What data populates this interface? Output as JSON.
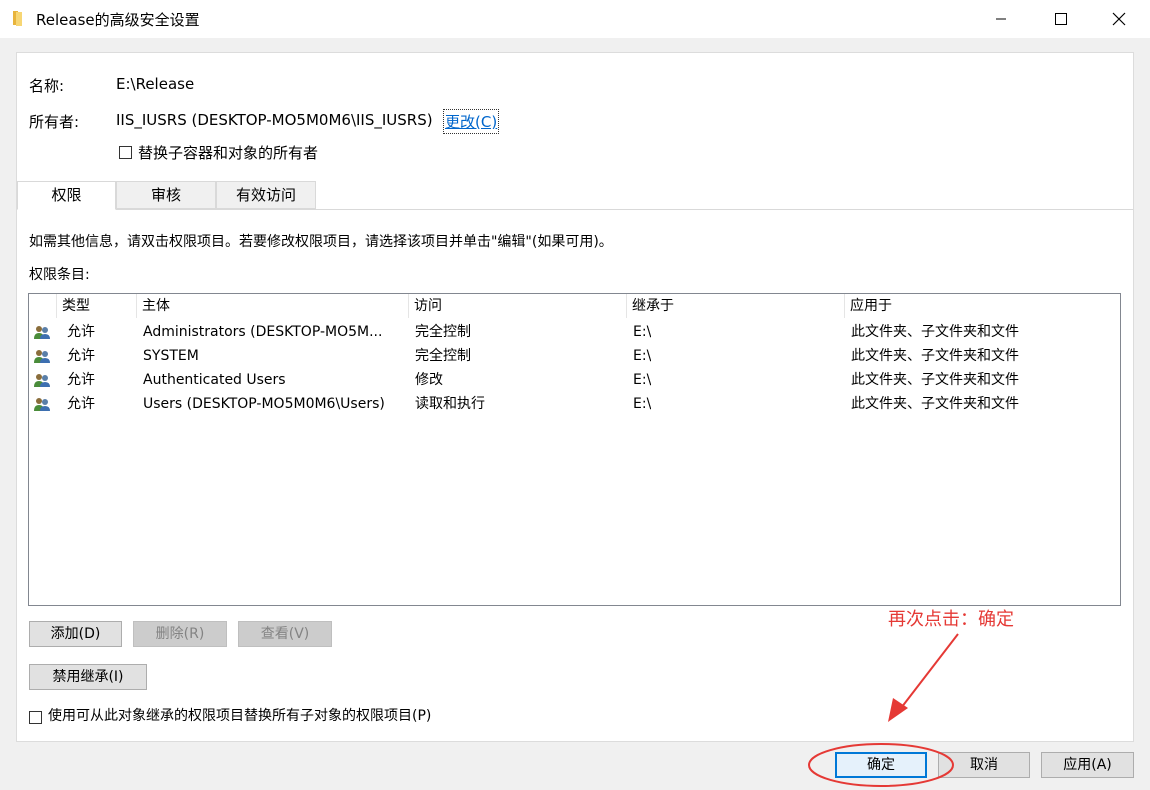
{
  "window": {
    "title": "Release的高级安全设置"
  },
  "info": {
    "name_label": "名称:",
    "name_value": "E:\\Release",
    "owner_label": "所有者:",
    "owner_value": "IIS_IUSRS (DESKTOP-MO5M0M6\\IIS_IUSRS)",
    "change_link": "更改(C)",
    "replace_owner_label": "替换子容器和对象的所有者"
  },
  "tabs": [
    {
      "label": "权限"
    },
    {
      "label": "审核"
    },
    {
      "label": "有效访问"
    }
  ],
  "content": {
    "instruction": "如需其他信息，请双击权限项目。若要修改权限项目，请选择该项目并单击\"编辑\"(如果可用)。",
    "entries_label": "权限条目:"
  },
  "table": {
    "columns": [
      "类型",
      "主体",
      "访问",
      "继承于",
      "应用于"
    ],
    "rows": [
      {
        "type": "允许",
        "principal": "Administrators (DESKTOP-MO5M...",
        "access": "完全控制",
        "inherited": "E:\\",
        "applies": "此文件夹、子文件夹和文件"
      },
      {
        "type": "允许",
        "principal": "SYSTEM",
        "access": "完全控制",
        "inherited": "E:\\",
        "applies": "此文件夹、子文件夹和文件"
      },
      {
        "type": "允许",
        "principal": "Authenticated Users",
        "access": "修改",
        "inherited": "E:\\",
        "applies": "此文件夹、子文件夹和文件"
      },
      {
        "type": "允许",
        "principal": "Users (DESKTOP-MO5M0M6\\Users)",
        "access": "读取和执行",
        "inherited": "E:\\",
        "applies": "此文件夹、子文件夹和文件"
      }
    ]
  },
  "buttons": {
    "add": "添加(D)",
    "remove": "删除(R)",
    "view": "查看(V)",
    "disable_inheritance": "禁用继承(I)",
    "ok": "确定",
    "cancel": "取消",
    "apply": "应用(A)"
  },
  "replace_child_label": "使用可从此对象继承的权限项目替换所有子对象的权限项目(P)",
  "annotation": {
    "text": "再次点击：确定",
    "color": "#e53935"
  }
}
